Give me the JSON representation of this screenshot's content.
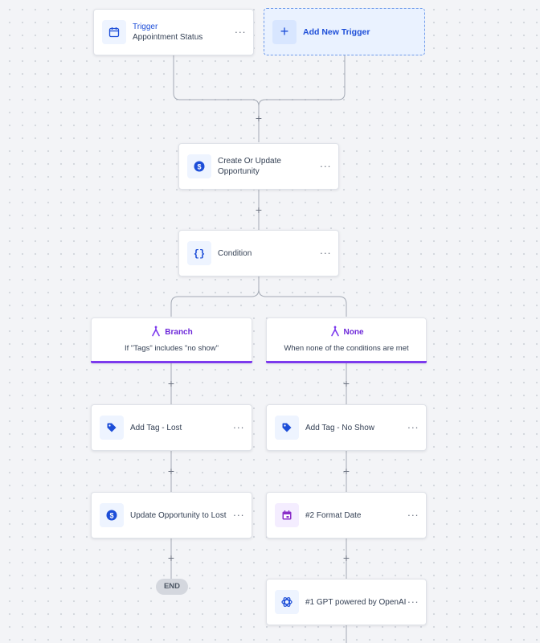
{
  "trigger": {
    "kicker": "Trigger",
    "name": "Appointment Status",
    "icon": "calendar-icon",
    "more": "···"
  },
  "add_trigger": {
    "label": "Add New Trigger",
    "plus": "+"
  },
  "add_step_symbol": "+",
  "steps": {
    "create_opportunity": {
      "label": "Create Or Update Opportunity",
      "icon": "dollar-icon",
      "more": "···"
    },
    "condition": {
      "label": "Condition",
      "icon": "braces-icon",
      "more": "···"
    }
  },
  "branches": {
    "left": {
      "title": "Branch",
      "description": "If \"Tags\" includes \"no show\"",
      "icon": "branch-split-icon"
    },
    "right": {
      "title": "None",
      "description": "When none of the conditions are met",
      "icon": "branch-split-icon"
    }
  },
  "left_steps": {
    "add_tag_lost": {
      "label": "Add Tag - Lost",
      "icon": "tag-icon",
      "more": "···"
    },
    "update_opportunity_lost": {
      "label": "Update Opportunity to Lost",
      "icon": "dollar-icon",
      "more": "···"
    },
    "end_label": "END"
  },
  "right_steps": {
    "add_tag_no_show": {
      "label": "Add Tag - No Show",
      "icon": "tag-icon",
      "more": "···"
    },
    "format_date": {
      "label": "#2 Format Date",
      "icon": "calendar-purple-icon",
      "more": "···"
    },
    "gpt": {
      "label": "#1 GPT powered by OpenAI",
      "icon": "openai-icon",
      "more": "···"
    }
  },
  "colors": {
    "accent_blue": "#1d4ed8",
    "branch_purple": "#7c3aed",
    "connector": "#a3a9b4",
    "canvas": "#f3f4f7"
  }
}
